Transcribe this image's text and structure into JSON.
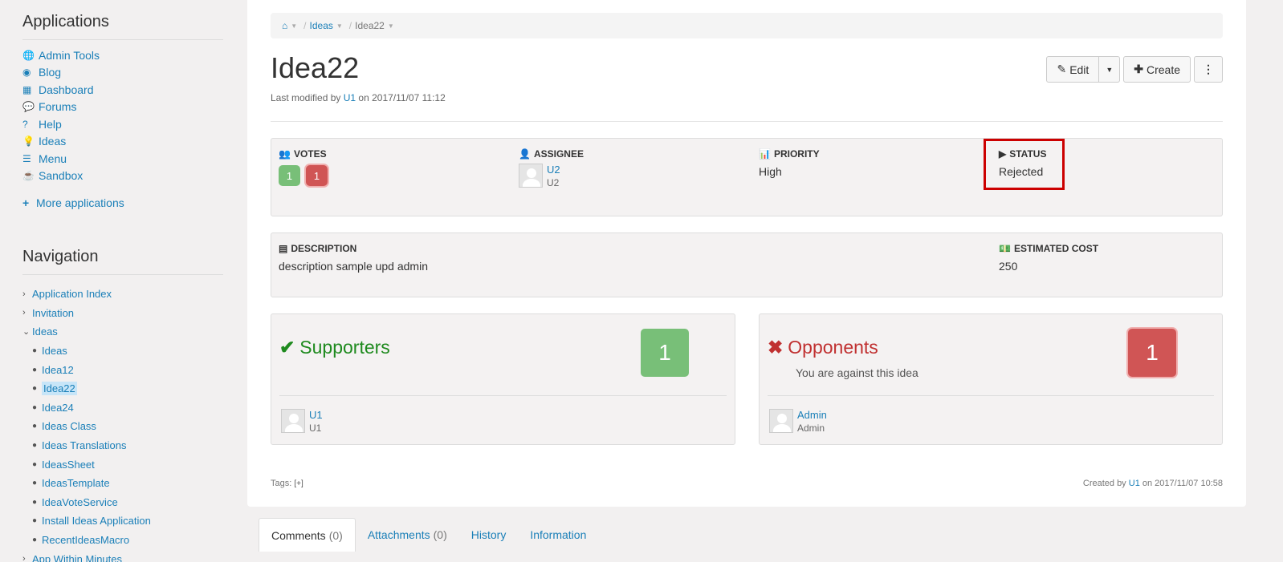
{
  "sidebar": {
    "applications_title": "Applications",
    "apps": [
      {
        "label": "Admin Tools",
        "icon": "globe-icon",
        "glyph": "🌐"
      },
      {
        "label": "Blog",
        "icon": "rss-icon",
        "glyph": "◉"
      },
      {
        "label": "Dashboard",
        "icon": "dashboard-icon",
        "glyph": "▦"
      },
      {
        "label": "Forums",
        "icon": "comments-icon",
        "glyph": "💬"
      },
      {
        "label": "Help",
        "icon": "question-icon",
        "glyph": "?"
      },
      {
        "label": "Ideas",
        "icon": "lightbulb-icon",
        "glyph": "💡"
      },
      {
        "label": "Menu",
        "icon": "list-icon",
        "glyph": "☰"
      },
      {
        "label": "Sandbox",
        "icon": "coffee-icon",
        "glyph": "☕"
      }
    ],
    "more_label": "More applications",
    "navigation_title": "Navigation",
    "nav": [
      {
        "label": "Application Index",
        "level": 0,
        "caret": "›"
      },
      {
        "label": "Invitation",
        "level": 0,
        "caret": "›"
      },
      {
        "label": "Ideas",
        "level": 0,
        "caret": "⌄"
      },
      {
        "label": "Ideas",
        "level": 1
      },
      {
        "label": "Idea12",
        "level": 1
      },
      {
        "label": "Idea22",
        "level": 1,
        "active": true
      },
      {
        "label": "Idea24",
        "level": 1
      },
      {
        "label": "Ideas Class",
        "level": 1
      },
      {
        "label": "Ideas Translations",
        "level": 1
      },
      {
        "label": "IdeasSheet",
        "level": 1
      },
      {
        "label": "IdeasTemplate",
        "level": 1
      },
      {
        "label": "IdeaVoteService",
        "level": 1
      },
      {
        "label": "Install Ideas Application",
        "level": 1
      },
      {
        "label": "RecentIdeasMacro",
        "level": 1
      },
      {
        "label": "App Within Minutes",
        "level": 0,
        "caret": "›"
      }
    ]
  },
  "breadcrumb": {
    "home_icon": "home-icon",
    "ideas": "Ideas",
    "current": "Idea22"
  },
  "page": {
    "title": "Idea22",
    "meta_prefix": "Last modified by",
    "meta_user": "U1",
    "meta_suffix": "on 2017/11/07 11:12"
  },
  "toolbar": {
    "edit": "Edit",
    "create": "Create"
  },
  "props": {
    "votes_label": "VOTES",
    "votes_up": "1",
    "votes_down": "1",
    "assignee_label": "ASSIGNEE",
    "assignee_name": "U2",
    "assignee_sub": "U2",
    "priority_label": "PRIORITY",
    "priority_value": "High",
    "status_label": "STATUS",
    "status_value": "Rejected"
  },
  "desc": {
    "description_label": "DESCRIPTION",
    "description_value": "description sample upd admin",
    "cost_label": "ESTIMATED COST",
    "cost_value": "250"
  },
  "supporters": {
    "title": "Supporters",
    "count": "1",
    "user": "U1",
    "user_sub": "U1"
  },
  "opponents": {
    "title": "Opponents",
    "subtitle": "You are against this idea",
    "count": "1",
    "user": "Admin",
    "user_sub": "Admin"
  },
  "footer": {
    "tags_label": "Tags:",
    "tags_add": "[+]",
    "created_prefix": "Created by",
    "created_user": "U1",
    "created_suffix": "on 2017/11/07 10:58"
  },
  "tabs": [
    {
      "label": "Comments",
      "count": "(0)",
      "active": true
    },
    {
      "label": "Attachments",
      "count": "(0)"
    },
    {
      "label": "History"
    },
    {
      "label": "Information"
    }
  ],
  "colors": {
    "link": "#1a7fb8",
    "support": "#1e8a1e",
    "oppose": "#c03030",
    "highlight": "#cc0000"
  }
}
